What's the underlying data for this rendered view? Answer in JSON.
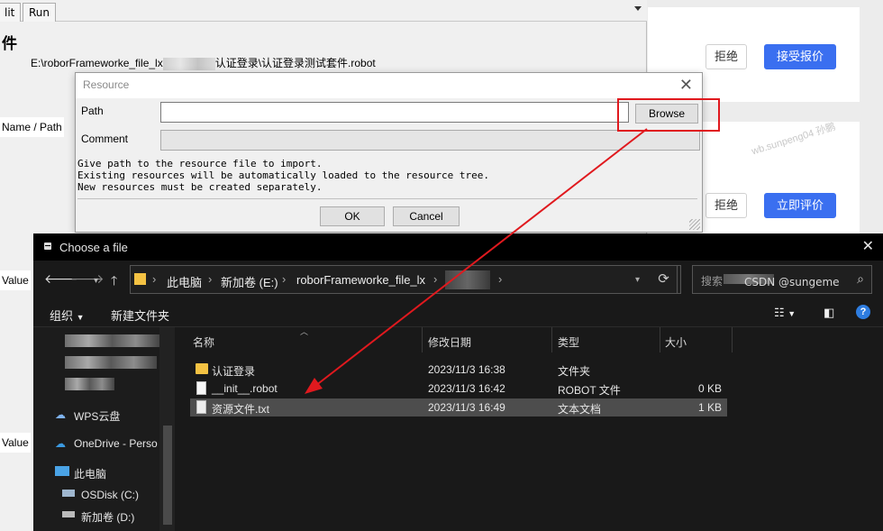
{
  "ride": {
    "tabs": [
      "lit",
      "Run"
    ],
    "heading": "件",
    "source_prefix": "E:\\roborFrameworke_file_lx",
    "source_suffix": "认证登录\\认证登录测试套件.robot",
    "label_name_path": "Name / Path",
    "label_value1": "Value",
    "label_value2": "Value"
  },
  "web": {
    "reject1": "拒绝",
    "accept_quote": "接受报价",
    "reject2": "拒绝",
    "evaluate_now": "立即评价",
    "watermark": "wb.sunpeng04 孙鹏",
    "accent": "#3a6ff0"
  },
  "resource_dialog": {
    "title": "Resource",
    "path_label": "Path",
    "path_value": "",
    "comment_label": "Comment",
    "browse_label": "Browse",
    "help_lines": [
      "Give path to the resource file to import.",
      "Existing resources will be automatically loaded to the resource tree.",
      "New resources must be created separately."
    ],
    "ok_label": "OK",
    "cancel_label": "Cancel"
  },
  "file_dialog": {
    "title": "Choose a file",
    "breadcrumbs": [
      "此电脑",
      "新加卷 (E:)",
      "roborFrameworke_file_lx"
    ],
    "search_placeholder": "搜索",
    "organize_label": "组织",
    "new_folder_label": "新建文件夹",
    "sidebar": {
      "wps": "WPS云盘",
      "onedrive": "OneDrive - Perso",
      "this_pc": "此电脑",
      "osdisk": "OSDisk (C:)",
      "drive_d": "新加卷 (D:)"
    },
    "columns": {
      "name": "名称",
      "modified": "修改日期",
      "type": "类型",
      "size": "大小"
    },
    "files": [
      {
        "name": "认证登录",
        "modified": "2023/11/3 16:38",
        "type": "文件夹",
        "size": "",
        "icon": "folder-icon"
      },
      {
        "name": "__init__.robot",
        "modified": "2023/11/3 16:42",
        "type": "ROBOT 文件",
        "size": "0 KB",
        "icon": "file-icon"
      },
      {
        "name": "资源文件.txt",
        "modified": "2023/11/3 16:49",
        "type": "文本文档",
        "size": "1 KB",
        "icon": "text-file-icon"
      }
    ]
  },
  "credit": "CSDN @sungeme",
  "annotation_color": "#e0191e"
}
